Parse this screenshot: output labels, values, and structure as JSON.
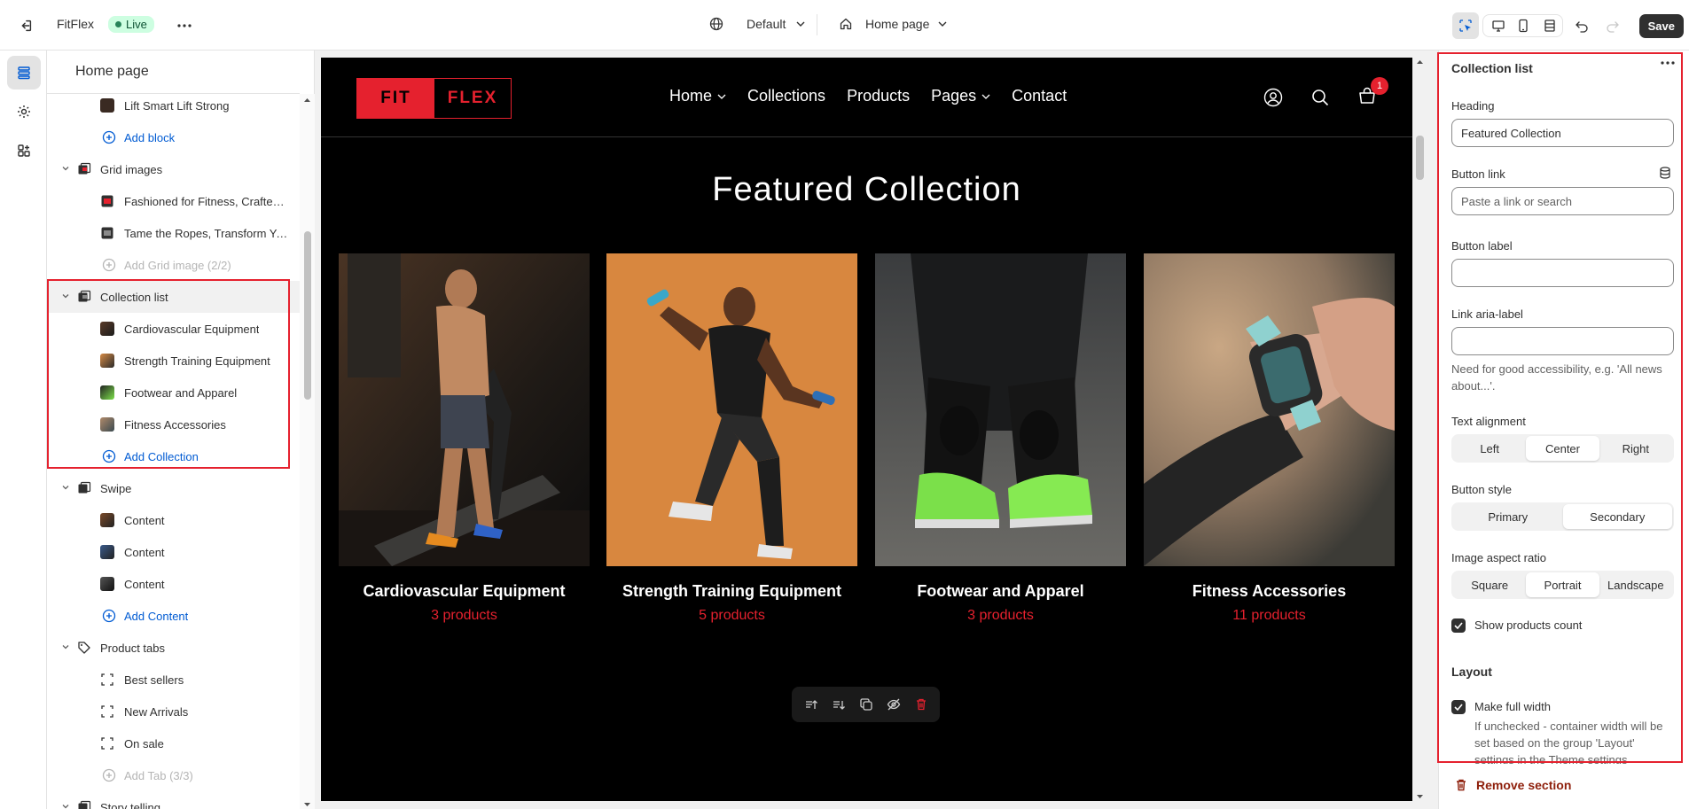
{
  "topbar": {
    "store_name": "FitFlex",
    "status": "Live",
    "theme": "Default",
    "page": "Home page",
    "save_label": "Save"
  },
  "sidebar": {
    "title": "Home page",
    "items": [
      {
        "label": "Lift Smart Lift Strong"
      },
      {
        "label": "Add block"
      },
      {
        "label": "Grid images"
      },
      {
        "label": "Fashioned for Fitness, Crafted for Comfort"
      },
      {
        "label": "Tame the Ropes, Transform Your Body"
      },
      {
        "label": "Add Grid image (2/2)"
      },
      {
        "label": "Collection list"
      },
      {
        "label": "Cardiovascular Equipment"
      },
      {
        "label": "Strength Training Equipment"
      },
      {
        "label": "Footwear and Apparel"
      },
      {
        "label": "Fitness Accessories"
      },
      {
        "label": "Add Collection"
      },
      {
        "label": "Swipe"
      },
      {
        "label": "Content"
      },
      {
        "label": "Content"
      },
      {
        "label": "Content"
      },
      {
        "label": "Add Content"
      },
      {
        "label": "Product tabs"
      },
      {
        "label": "Best sellers"
      },
      {
        "label": "New Arrivals"
      },
      {
        "label": "On sale"
      },
      {
        "label": "Add Tab (3/3)"
      },
      {
        "label": "Story telling"
      }
    ]
  },
  "preview": {
    "logo_left": "FIT",
    "logo_right": "FLEX",
    "nav": [
      "Home",
      "Collections",
      "Products",
      "Pages",
      "Contact"
    ],
    "cart_count": "1",
    "heading": "Featured Collection",
    "cards": [
      {
        "title": "Cardiovascular Equipment",
        "count": "3 products"
      },
      {
        "title": "Strength Training Equipment",
        "count": "5 products"
      },
      {
        "title": "Footwear and Apparel",
        "count": "3 products"
      },
      {
        "title": "Fitness Accessories",
        "count": "11 products"
      }
    ]
  },
  "panel": {
    "title": "Collection list",
    "heading_label": "Heading",
    "heading_value": "Featured Collection",
    "button_link_label": "Button link",
    "button_link_placeholder": "Paste a link or search",
    "button_label_label": "Button label",
    "aria_label": "Link aria-label",
    "aria_help": "Need for good accessibility, e.g. 'All news about...'.",
    "text_alignment_label": "Text alignment",
    "text_alignment": [
      "Left",
      "Center",
      "Right"
    ],
    "text_alignment_selected": "Center",
    "button_style_label": "Button style",
    "button_style": [
      "Primary",
      "Secondary"
    ],
    "button_style_selected": "Secondary",
    "aspect_label": "Image aspect ratio",
    "aspect": [
      "Square",
      "Portrait",
      "Landscape"
    ],
    "aspect_selected": "Portrait",
    "show_count_label": "Show products count",
    "layout_section": "Layout",
    "full_width_label": "Make full width",
    "full_width_help": "If unchecked - container width will be set based on the group 'Layout' settings in the Theme settings",
    "remove_label": "Remove section"
  },
  "colors": {
    "accent": "#e5212e",
    "link": "#005bd3",
    "dark": "#303030"
  }
}
